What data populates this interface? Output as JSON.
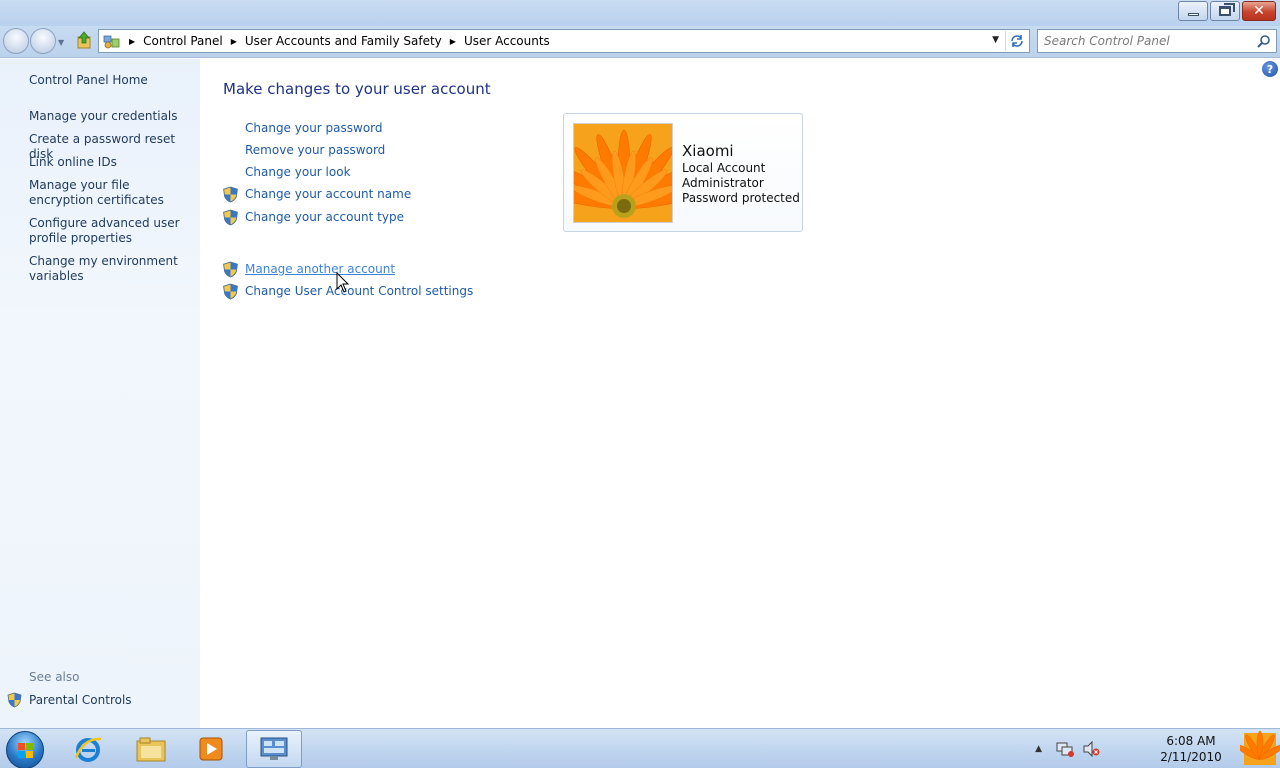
{
  "window": {
    "minimize_label": "–",
    "close_label": "✕"
  },
  "navbar": {
    "breadcrumbs": [
      "Control Panel",
      "User Accounts and Family Safety",
      "User Accounts"
    ],
    "search_placeholder": "Search Control Panel"
  },
  "sidebar": {
    "home_label": "Control Panel Home",
    "items": [
      {
        "label": "Manage your credentials"
      },
      {
        "label": "Create a password reset disk"
      },
      {
        "label": "Link online IDs"
      },
      {
        "label": "Manage your file encryption certificates"
      },
      {
        "label": "Configure advanced user profile properties"
      },
      {
        "label": "Change my environment variables"
      }
    ],
    "see_also_label": "See also",
    "parental_label": "Parental Controls"
  },
  "main": {
    "title": "Make changes to your user account",
    "tasks": [
      {
        "label": "Change your password",
        "shield": false
      },
      {
        "label": "Remove your password",
        "shield": false
      },
      {
        "label": "Change your look",
        "shield": false
      },
      {
        "label": "Change your account name",
        "shield": true
      },
      {
        "label": "Change your account type",
        "shield": true
      }
    ],
    "other_tasks": [
      {
        "label": "Manage another account",
        "shield": true,
        "hovered": true
      },
      {
        "label": "Change User Account Control settings",
        "shield": true
      }
    ],
    "help_label": "?"
  },
  "account": {
    "name": "Xiaomi",
    "lines": [
      "Local Account",
      "Administrator",
      "Password protected"
    ]
  },
  "taskbar": {
    "time": "6:08 AM",
    "date": "2/11/2010"
  },
  "colors": {
    "link": "#1e5aa8",
    "title": "#1e3287",
    "sidebar_link": "#1e395b"
  }
}
